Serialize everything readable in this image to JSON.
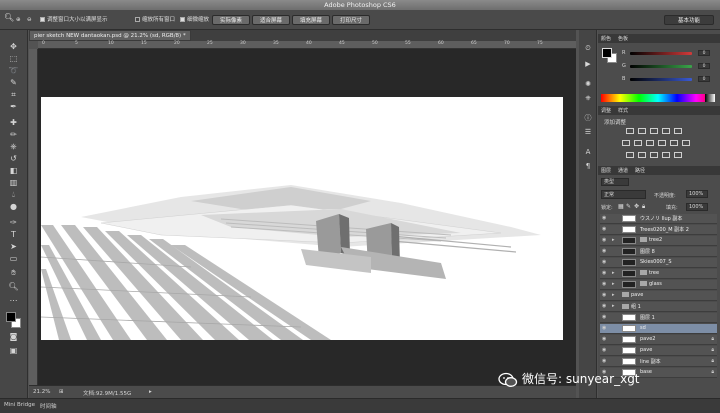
{
  "window": {
    "title": "Adobe Photoshop CS6"
  },
  "options_bar": {
    "checkbox_resize_windows": "调整窗口大小以满屏显示",
    "checkbox_zoom_all": "缩放所有窗口",
    "checkbox_scrubby": "细微缩放",
    "btn_actual_pixels": "实际像素",
    "btn_fit_screen": "适合屏幕",
    "btn_fill_screen": "填充屏幕",
    "btn_print_size": "打印尺寸",
    "workspace": "基本功能"
  },
  "document": {
    "tab_label": "pier sketch NEW dantaokan.psd @ 21.2% (sd, RGB/8) *",
    "ruler_marks": [
      "0",
      "5",
      "10",
      "15",
      "20",
      "25",
      "30",
      "35",
      "40",
      "45",
      "50",
      "55",
      "60",
      "65",
      "70",
      "75"
    ]
  },
  "status": {
    "zoom": "21.2%",
    "doc_size": "文档:92.9M/1.55G"
  },
  "bottom_tabs": {
    "mini_bridge": "Mini Bridge",
    "timeline": "时间轴"
  },
  "color_panel": {
    "tabs": [
      "颜色",
      "色板"
    ],
    "channels": [
      {
        "label": "R",
        "value": "0",
        "color": "#d23a3a"
      },
      {
        "label": "G",
        "value": "0",
        "color": "#3aa54a"
      },
      {
        "label": "B",
        "value": "0",
        "color": "#3a5ad2"
      }
    ]
  },
  "adjustments_panel": {
    "tabs": [
      "调整",
      "样式"
    ],
    "title": "添加调整"
  },
  "layers_panel": {
    "tabs": [
      "图层",
      "通道",
      "路径"
    ],
    "filter_kind": "类型",
    "blend_mode": "正常",
    "opacity_label": "不透明度:",
    "opacity_value": "100%",
    "lock_label": "锁定:",
    "fill_label": "填充:",
    "fill_value": "100%",
    "layers": [
      {
        "name": "ウスノリ Ilup 副本",
        "thumb": "light",
        "folder": false,
        "lock": false,
        "selected": false
      },
      {
        "name": "Trees0200_M 副本 2",
        "thumb": "light",
        "folder": false,
        "lock": false,
        "selected": false
      },
      {
        "name": "tree2",
        "thumb": "dark",
        "folder": true,
        "lock": false,
        "selected": false
      },
      {
        "name": "图层 8",
        "thumb": "dark",
        "folder": false,
        "lock": false,
        "selected": false
      },
      {
        "name": "Skies0007_S",
        "thumb": "dark",
        "folder": false,
        "lock": false,
        "selected": false
      },
      {
        "name": "tree",
        "thumb": "dark",
        "folder": true,
        "lock": false,
        "selected": false
      },
      {
        "name": "glass",
        "thumb": "dark",
        "folder": true,
        "lock": false,
        "selected": false
      },
      {
        "name": "pave",
        "thumb": "none",
        "folder": true,
        "lock": false,
        "selected": false
      },
      {
        "name": "组 1",
        "thumb": "none",
        "folder": true,
        "lock": false,
        "selected": false
      },
      {
        "name": "图层 1",
        "thumb": "light",
        "folder": false,
        "lock": false,
        "selected": false
      },
      {
        "name": "sd",
        "thumb": "light",
        "folder": false,
        "lock": false,
        "selected": true
      },
      {
        "name": "pave2",
        "thumb": "light",
        "folder": false,
        "lock": true,
        "selected": false
      },
      {
        "name": "pave",
        "thumb": "light",
        "folder": false,
        "lock": true,
        "selected": false
      },
      {
        "name": "line 副本",
        "thumb": "light",
        "folder": false,
        "lock": true,
        "selected": false
      },
      {
        "name": "base",
        "thumb": "light",
        "folder": false,
        "lock": true,
        "selected": false
      }
    ]
  },
  "watermark": {
    "text": "微信号: sunyear_xgt"
  }
}
